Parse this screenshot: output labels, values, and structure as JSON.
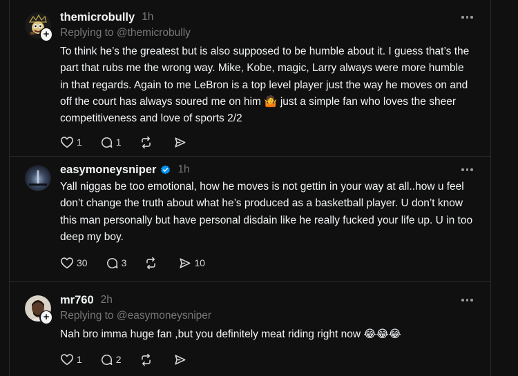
{
  "posts": [
    {
      "username": "themicrobully",
      "time": "1h",
      "replying_to": "Replying to @themicrobully",
      "text": "To think he’s the greatest but is also supposed to be humble about it. I guess that’s the part that rubs me the wrong way. Mike, Kobe, magic, Larry always were more humble in that regards. Again to me LeBron is a top level player just the way he moves on and off the court has always soured me on him 🤷 just a simple fan who loves the sheer competitiveness and love of sports 2/2",
      "likes": "1",
      "replies": "1",
      "reposts": "",
      "shares": ""
    },
    {
      "username": "easymoneysniper",
      "time": "1h",
      "verified": true,
      "text": "Yall niggas be too emotional, how he moves is not gettin in your way at all..how u feel don’t change the truth about what he’s produced as a basketball player. U don’t know this man personally but have personal disdain like he really fucked your life up. U in too deep my boy.",
      "likes": "30",
      "replies": "3",
      "reposts": "",
      "shares": "10"
    },
    {
      "username": "mr760",
      "time": "2h",
      "replying_to": "Replying to @easymoneysniper",
      "text": "Nah bro imma huge fan ,but you definitely meat riding right now 😂😂😂",
      "likes": "1",
      "replies": "2",
      "reposts": "",
      "shares": ""
    }
  ],
  "colors": {
    "background": "#101010",
    "text": "#f3f5f7",
    "muted": "#777777",
    "verified": "#0095f6"
  },
  "icons": [
    "heart-icon",
    "comment-icon",
    "repost-icon",
    "share-icon",
    "more-icon",
    "plus-icon",
    "verified-icon"
  ]
}
